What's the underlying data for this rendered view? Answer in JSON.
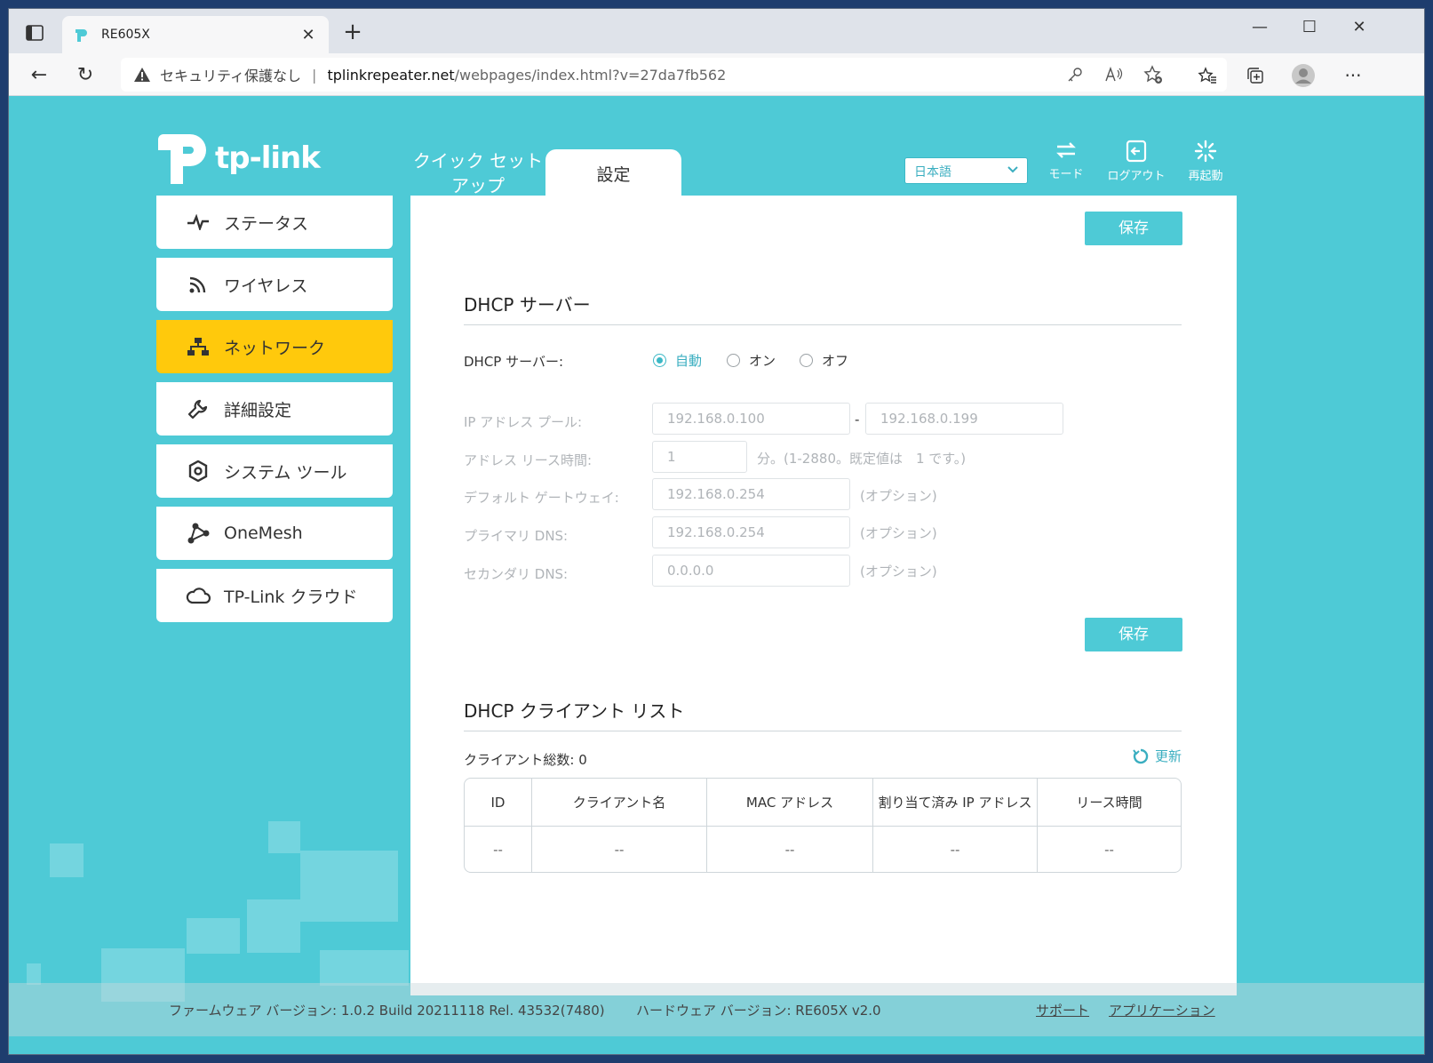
{
  "browser": {
    "tab_title": "RE605X",
    "address_security": "セキュリティ保護なし",
    "address_separator": "|",
    "address_host": "tplinkrepeater.net",
    "address_path": "/webpages/index.html?v=27da7fb562"
  },
  "header": {
    "logo_text": "tp-link",
    "tab_quick_setup": "クイック セット アップ",
    "tab_settings": "設定",
    "language": "日本語",
    "btn_mode": "モード",
    "btn_logout": "ログアウト",
    "btn_reboot": "再起動"
  },
  "sidebar": {
    "items": [
      {
        "label": "ステータス"
      },
      {
        "label": "ワイヤレス"
      },
      {
        "label": "ネットワーク"
      },
      {
        "label": "詳細設定"
      },
      {
        "label": "システム ツール"
      },
      {
        "label": "OneMesh"
      },
      {
        "label": "TP-Link クラウド"
      }
    ]
  },
  "content": {
    "save_label": "保存",
    "dhcp_server_title": "DHCP サーバー",
    "dhcp_server_label": "DHCP サーバー:",
    "radio_auto": "自動",
    "radio_on": "オン",
    "radio_off": "オフ",
    "ip_pool_label": "IP アドレス プール:",
    "ip_pool_start": "192.168.0.100",
    "ip_pool_dash": "-",
    "ip_pool_end": "192.168.0.199",
    "lease_label": "アドレス リース時間:",
    "lease_value": "1",
    "lease_hint": "分。(1-2880。既定値は　1 です。)",
    "gateway_label": "デフォルト ゲートウェイ:",
    "gateway_value": "192.168.0.254",
    "optional_hint": "(オプション)",
    "primary_dns_label": "プライマリ DNS:",
    "primary_dns_value": "192.168.0.254",
    "secondary_dns_label": "セカンダリ DNS:",
    "secondary_dns_value": "0.0.0.0",
    "client_list_title": "DHCP クライアント リスト",
    "client_total": "クライアント総数: 0",
    "refresh_label": "更新",
    "table": {
      "headers": [
        "ID",
        "クライアント名",
        "MAC アドレス",
        "割り当て済み IP アドレス",
        "リース時間"
      ],
      "row": [
        "--",
        "--",
        "--",
        "--",
        "--"
      ]
    }
  },
  "footer": {
    "firmware": "ファームウェア バージョン: 1.0.2 Build 20211118 Rel. 43532(7480)",
    "hardware": "ハードウェア バージョン: RE605X v2.0",
    "support": "サポート",
    "app": "アプリケーション"
  }
}
